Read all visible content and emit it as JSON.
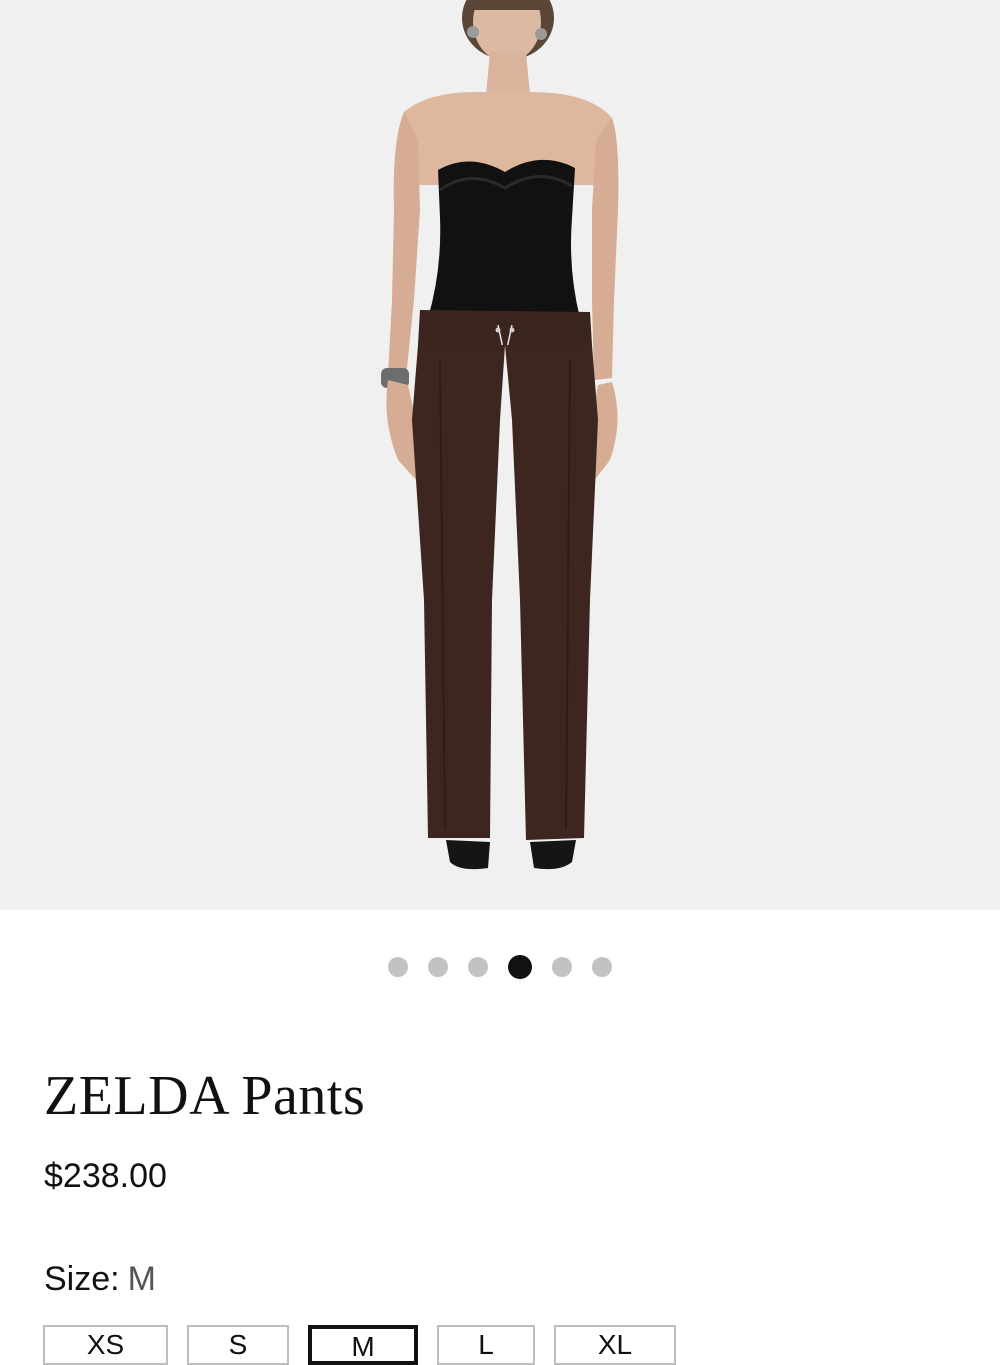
{
  "gallery": {
    "image_alt": "Model wearing ZELDA Pants",
    "slide_count": 6,
    "active_slide": 4,
    "colors": {
      "background": "#f0f0f0",
      "pants": "#3d2620",
      "bodysuit": "#111111"
    }
  },
  "product": {
    "title": "ZELDA Pants",
    "price": "$238.00"
  },
  "size": {
    "label": "Size:",
    "selected_value": "M",
    "options": [
      "XS",
      "S",
      "M",
      "L",
      "XL"
    ],
    "selected_index": 2
  }
}
